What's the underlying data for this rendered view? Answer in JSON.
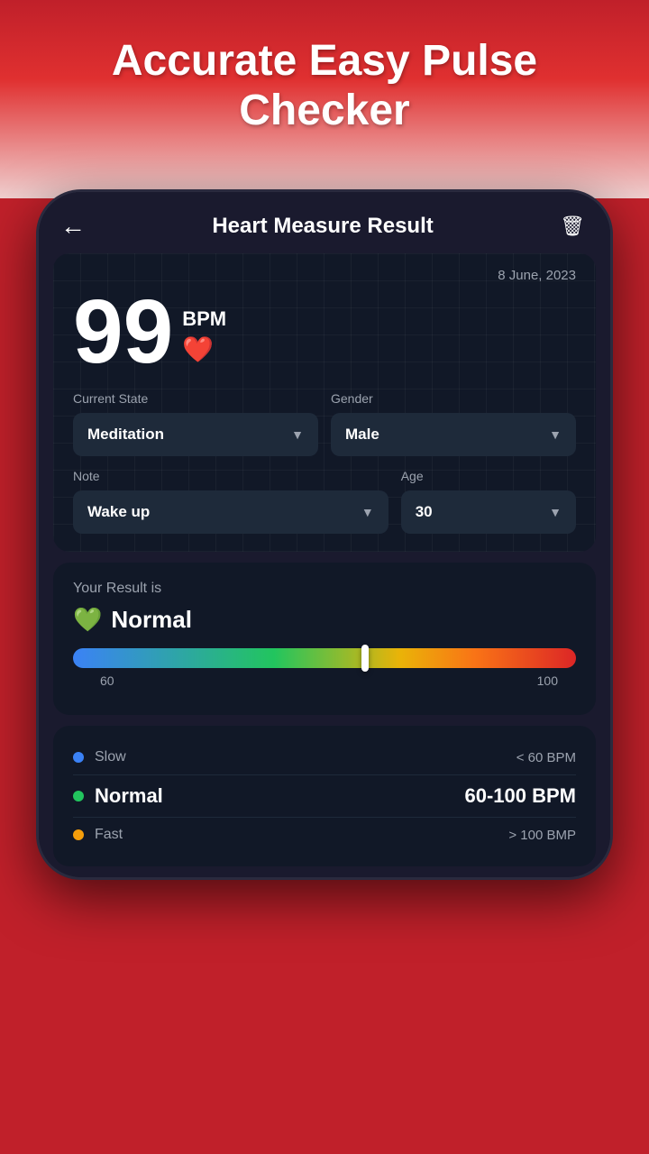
{
  "header": {
    "title": "Accurate Easy Pulse Checker"
  },
  "topbar": {
    "back_label": "←",
    "title": "Heart Measure Result",
    "delete_label": "🗑"
  },
  "bpm_card": {
    "date": "8 June, 2023",
    "bpm_value": "99",
    "bpm_unit": "BPM",
    "heart_icon": "❤️",
    "current_state_label": "Current State",
    "current_state_value": "Meditation",
    "gender_label": "Gender",
    "gender_value": "Male",
    "note_label": "Note",
    "note_value": "Wake up",
    "age_label": "Age",
    "age_value": "30"
  },
  "result_card": {
    "label": "Your Result is",
    "status": "Normal",
    "slider_60": "60",
    "slider_100": "100"
  },
  "legend": {
    "rows": [
      {
        "dot_color": "#3b82f6",
        "label": "Slow",
        "value": "< 60 BPM",
        "bold": false
      },
      {
        "dot_color": "#22c55e",
        "label": "Normal",
        "value": "60-100 BPM",
        "bold": true
      },
      {
        "dot_color": "#f59e0b",
        "label": "Fast",
        "value": "> 100 BMP",
        "bold": false
      }
    ]
  },
  "colors": {
    "accent_red": "#c0202a",
    "bg_dark": "#1a1a2e",
    "card_bg": "#111827"
  }
}
